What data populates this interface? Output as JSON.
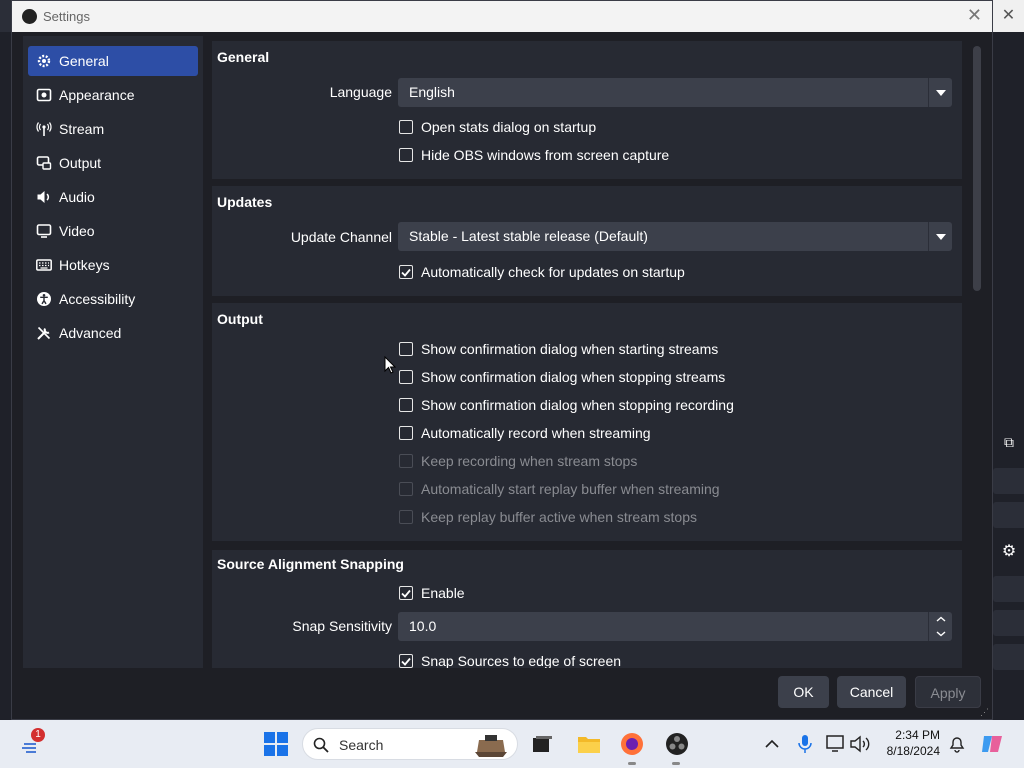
{
  "window": {
    "title": "Settings",
    "close": "✕"
  },
  "sidebar": {
    "items": [
      {
        "label": "General",
        "icon": "gear-icon"
      },
      {
        "label": "Appearance",
        "icon": "appearance-icon"
      },
      {
        "label": "Stream",
        "icon": "antenna-icon"
      },
      {
        "label": "Output",
        "icon": "output-icon"
      },
      {
        "label": "Audio",
        "icon": "speaker-icon"
      },
      {
        "label": "Video",
        "icon": "monitor-icon"
      },
      {
        "label": "Hotkeys",
        "icon": "keyboard-icon"
      },
      {
        "label": "Accessibility",
        "icon": "accessibility-icon"
      },
      {
        "label": "Advanced",
        "icon": "wrench-icon"
      }
    ],
    "selected": "General"
  },
  "general": {
    "title": "General",
    "language_label": "Language",
    "language_value": "English",
    "chk_stats": "Open stats dialog on startup",
    "chk_hide": "Hide OBS windows from screen capture"
  },
  "updates": {
    "title": "Updates",
    "channel_label": "Update Channel",
    "channel_value": "Stable - Latest stable release (Default)",
    "chk_auto": "Automatically check for updates on startup"
  },
  "output": {
    "title": "Output",
    "items": [
      {
        "label": "Show confirmation dialog when starting streams",
        "checked": false,
        "enabled": true
      },
      {
        "label": "Show confirmation dialog when stopping streams",
        "checked": false,
        "enabled": true
      },
      {
        "label": "Show confirmation dialog when stopping recording",
        "checked": false,
        "enabled": true
      },
      {
        "label": "Automatically record when streaming",
        "checked": false,
        "enabled": true
      },
      {
        "label": "Keep recording when stream stops",
        "checked": false,
        "enabled": false
      },
      {
        "label": "Automatically start replay buffer when streaming",
        "checked": false,
        "enabled": false
      },
      {
        "label": "Keep replay buffer active when stream stops",
        "checked": false,
        "enabled": false
      }
    ]
  },
  "snapping": {
    "title": "Source Alignment Snapping",
    "enable": "Enable",
    "sensitivity_label": "Snap Sensitivity",
    "sensitivity_value": "10.0",
    "edge": "Snap Sources to edge of screen"
  },
  "buttons": {
    "ok": "OK",
    "cancel": "Cancel",
    "apply": "Apply"
  },
  "taskbar": {
    "search": "Search",
    "time": "2:34 PM",
    "date": "8/18/2024",
    "badge": "1"
  },
  "colors": {
    "accent": "#2d4ea6",
    "panel": "#272a33",
    "field": "#3c404b"
  }
}
